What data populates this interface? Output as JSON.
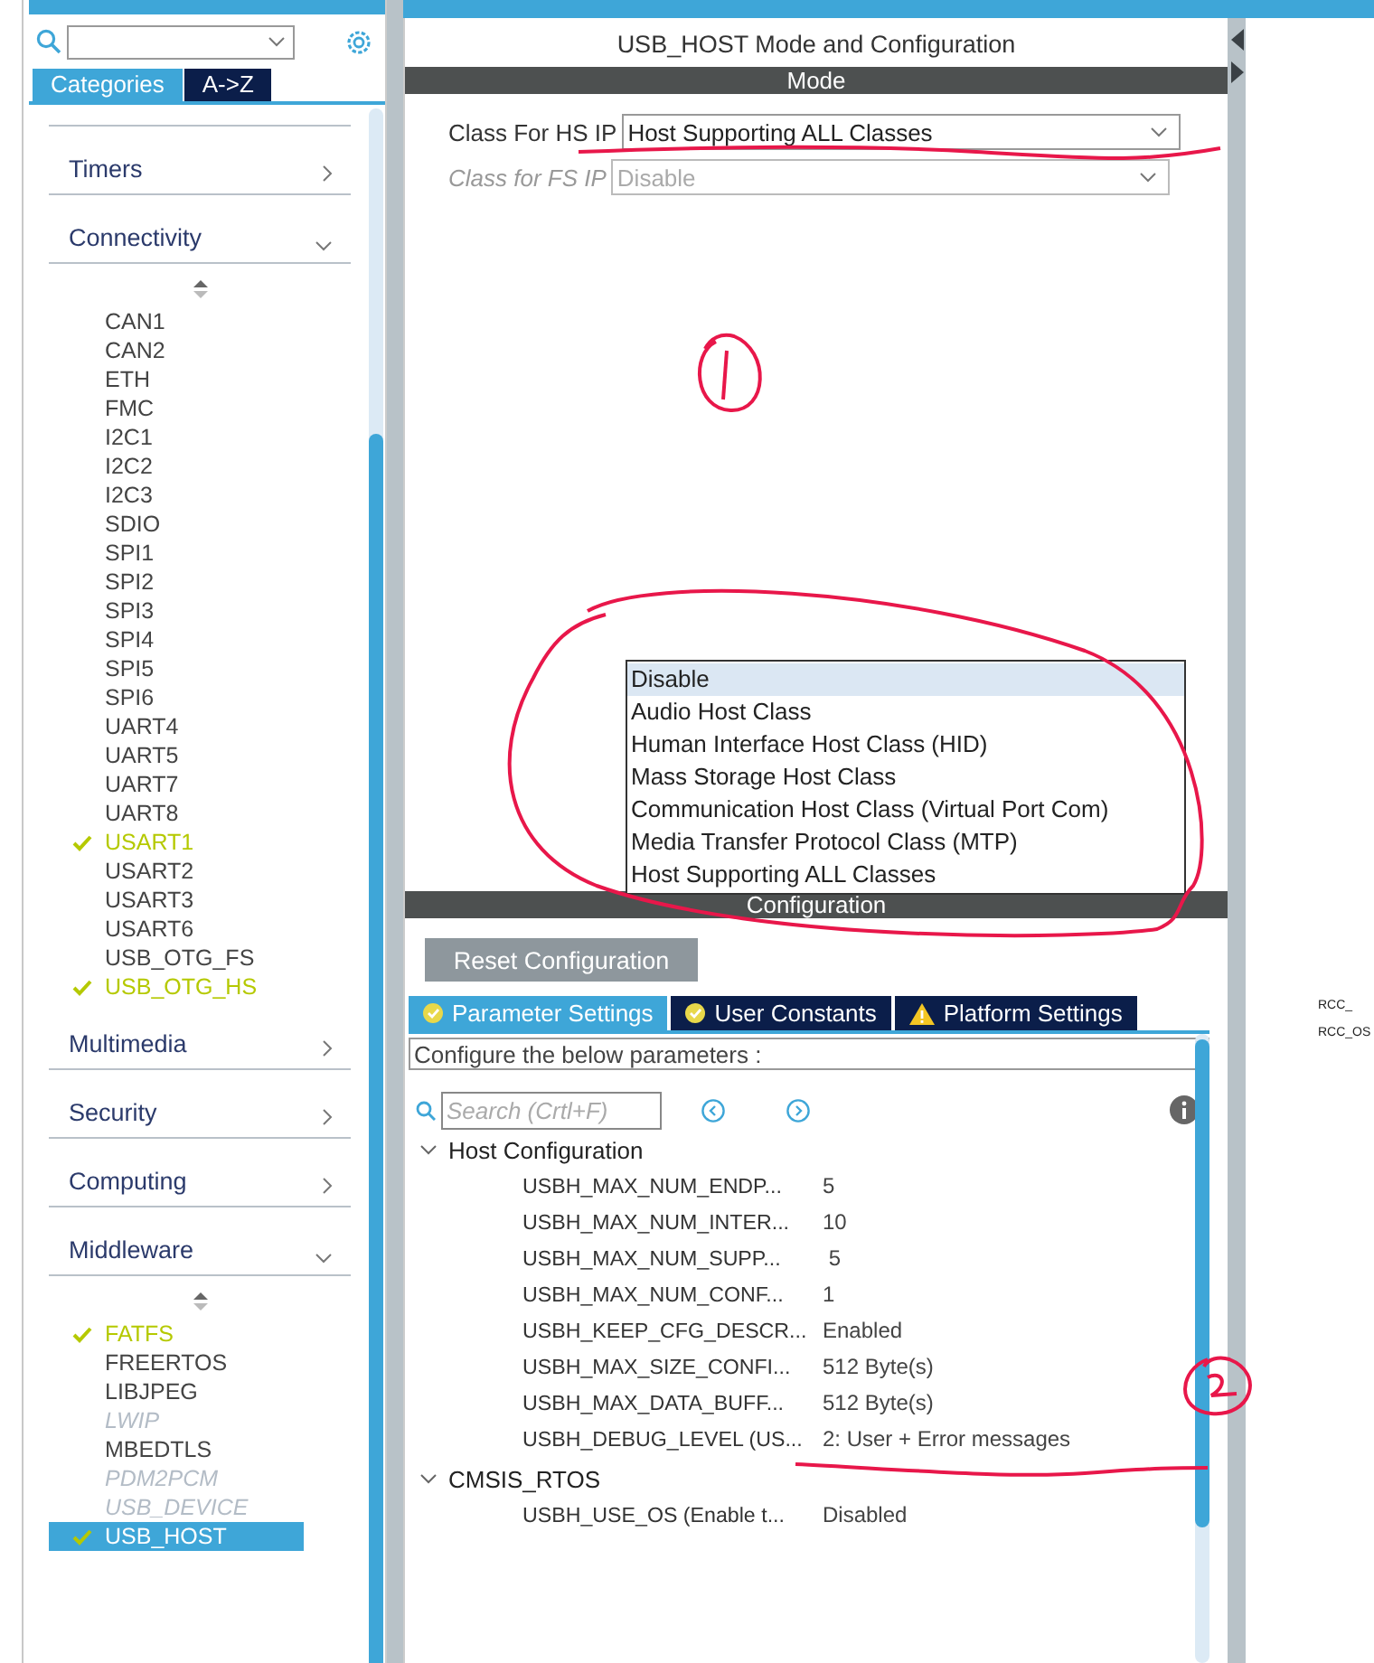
{
  "sidebar": {
    "tabs": [
      {
        "label": "Categories",
        "selected": true
      },
      {
        "label": "A->Z",
        "selected": false
      }
    ],
    "categories": [
      {
        "label": "Timers",
        "expanded": false
      },
      {
        "label": "Connectivity",
        "expanded": true,
        "items": [
          {
            "label": "CAN1",
            "checked": false,
            "disabled": false,
            "selected": false
          },
          {
            "label": "CAN2",
            "checked": false,
            "disabled": false,
            "selected": false
          },
          {
            "label": "ETH",
            "checked": false,
            "disabled": false,
            "selected": false
          },
          {
            "label": "FMC",
            "checked": false,
            "disabled": false,
            "selected": false
          },
          {
            "label": "I2C1",
            "checked": false,
            "disabled": false,
            "selected": false
          },
          {
            "label": "I2C2",
            "checked": false,
            "disabled": false,
            "selected": false
          },
          {
            "label": "I2C3",
            "checked": false,
            "disabled": false,
            "selected": false
          },
          {
            "label": "SDIO",
            "checked": false,
            "disabled": false,
            "selected": false
          },
          {
            "label": "SPI1",
            "checked": false,
            "disabled": false,
            "selected": false
          },
          {
            "label": "SPI2",
            "checked": false,
            "disabled": false,
            "selected": false
          },
          {
            "label": "SPI3",
            "checked": false,
            "disabled": false,
            "selected": false
          },
          {
            "label": "SPI4",
            "checked": false,
            "disabled": false,
            "selected": false
          },
          {
            "label": "SPI5",
            "checked": false,
            "disabled": false,
            "selected": false
          },
          {
            "label": "SPI6",
            "checked": false,
            "disabled": false,
            "selected": false
          },
          {
            "label": "UART4",
            "checked": false,
            "disabled": false,
            "selected": false
          },
          {
            "label": "UART5",
            "checked": false,
            "disabled": false,
            "selected": false
          },
          {
            "label": "UART7",
            "checked": false,
            "disabled": false,
            "selected": false
          },
          {
            "label": "UART8",
            "checked": false,
            "disabled": false,
            "selected": false
          },
          {
            "label": "USART1",
            "checked": true,
            "disabled": false,
            "selected": false
          },
          {
            "label": "USART2",
            "checked": false,
            "disabled": false,
            "selected": false
          },
          {
            "label": "USART3",
            "checked": false,
            "disabled": false,
            "selected": false
          },
          {
            "label": "USART6",
            "checked": false,
            "disabled": false,
            "selected": false
          },
          {
            "label": "USB_OTG_FS",
            "checked": false,
            "disabled": false,
            "selected": false
          },
          {
            "label": "USB_OTG_HS",
            "checked": true,
            "disabled": false,
            "selected": false
          }
        ]
      },
      {
        "label": "Multimedia",
        "expanded": false
      },
      {
        "label": "Security",
        "expanded": false
      },
      {
        "label": "Computing",
        "expanded": false
      },
      {
        "label": "Middleware",
        "expanded": true,
        "items": [
          {
            "label": "FATFS",
            "checked": true,
            "disabled": false,
            "selected": false
          },
          {
            "label": "FREERTOS",
            "checked": false,
            "disabled": false,
            "selected": false
          },
          {
            "label": "LIBJPEG",
            "checked": false,
            "disabled": false,
            "selected": false
          },
          {
            "label": "LWIP",
            "checked": false,
            "disabled": true,
            "selected": false
          },
          {
            "label": "MBEDTLS",
            "checked": false,
            "disabled": false,
            "selected": false
          },
          {
            "label": "PDM2PCM",
            "checked": false,
            "disabled": true,
            "selected": false
          },
          {
            "label": "USB_DEVICE",
            "checked": false,
            "disabled": true,
            "selected": false
          },
          {
            "label": "USB_HOST",
            "checked": true,
            "disabled": false,
            "selected": true
          }
        ]
      }
    ]
  },
  "main": {
    "title": "USB_HOST Mode and Configuration",
    "mode_header": "Mode",
    "fields": [
      {
        "label": "Class For HS IP",
        "value": "Host Supporting ALL Classes",
        "disabled": false
      },
      {
        "label": "Class for FS IP",
        "value": "Disable",
        "disabled": true
      }
    ],
    "dropdown_options": [
      {
        "label": "Disable",
        "selected": true
      },
      {
        "label": "Audio Host Class",
        "selected": false
      },
      {
        "label": "Human Interface Host Class (HID)",
        "selected": false
      },
      {
        "label": "Mass Storage Host Class",
        "selected": false
      },
      {
        "label": "Communication Host Class (Virtual Port Com)",
        "selected": false
      },
      {
        "label": "Media Transfer Protocol Class (MTP)",
        "selected": false
      },
      {
        "label": "Host Supporting ALL Classes",
        "selected": false
      }
    ],
    "config_header": "Configuration",
    "reset_button": "Reset Configuration",
    "tabs": [
      {
        "label": "Parameter Settings",
        "kind": "ok",
        "selected": true
      },
      {
        "label": "User Constants",
        "kind": "ok",
        "selected": false
      },
      {
        "label": "Platform Settings",
        "kind": "warning",
        "selected": false
      }
    ],
    "description": "Configure the below parameters :",
    "search": {
      "placeholder": "Search (Crtl+F)"
    },
    "groups": [
      {
        "label": "Host Configuration",
        "expanded": true,
        "params": [
          {
            "name": "USBH_MAX_NUM_ENDP...",
            "value": "5"
          },
          {
            "name": "USBH_MAX_NUM_INTER...",
            "value": "10"
          },
          {
            "name": "USBH_MAX_NUM_SUPP...",
            "value": " 5"
          },
          {
            "name": "USBH_MAX_NUM_CONF...",
            "value": "1"
          },
          {
            "name": "USBH_KEEP_CFG_DESCR...",
            "value": "Enabled"
          },
          {
            "name": "USBH_MAX_SIZE_CONFI...",
            "value": "512 Byte(s)"
          },
          {
            "name": "USBH_MAX_DATA_BUFF...",
            "value": "512 Byte(s)"
          },
          {
            "name": "USBH_DEBUG_LEVEL (US...",
            "value": "2: User + Error messages"
          }
        ]
      },
      {
        "label": "CMSIS_RTOS",
        "expanded": true,
        "params": [
          {
            "name": "USBH_USE_OS (Enable t...",
            "value": "Disabled"
          }
        ]
      }
    ]
  },
  "side_labels": [
    "RCC_",
    "RCC_OS"
  ]
}
